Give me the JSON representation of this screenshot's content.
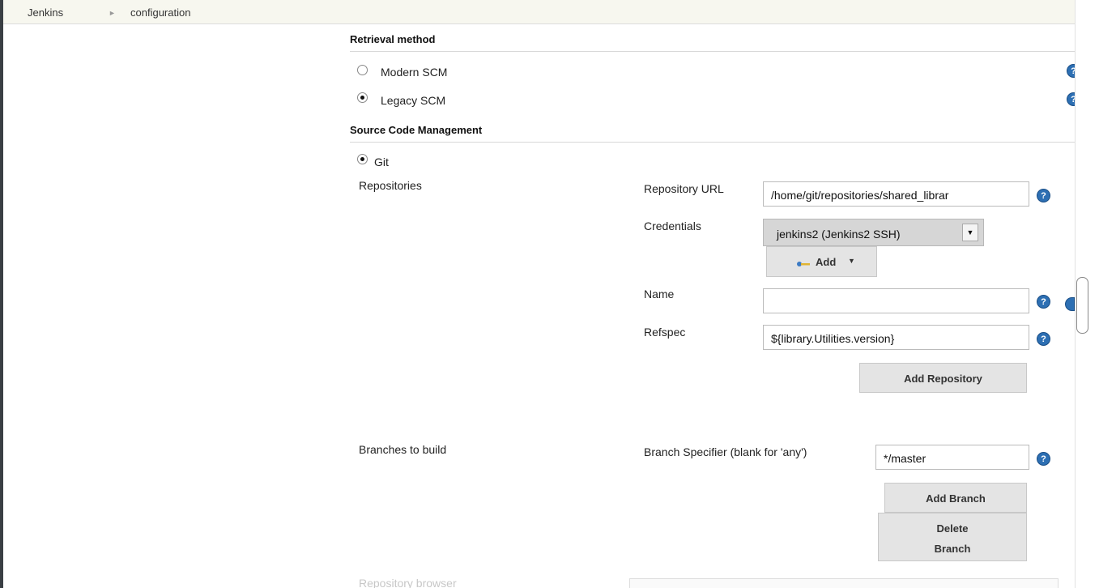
{
  "breadcrumb": {
    "root": "Jenkins",
    "page": "configuration"
  },
  "retrieval": {
    "title": "Retrieval method",
    "options": [
      {
        "label": "Modern SCM",
        "checked": false
      },
      {
        "label": "Legacy SCM",
        "checked": true
      }
    ]
  },
  "scm": {
    "title": "Source Code Management",
    "git_label": "Git",
    "repositories_label": "Repositories",
    "repo_url_label": "Repository URL",
    "repo_url_value": "/home/git/repositories/shared_librar",
    "credentials_label": "Credentials",
    "credentials_value": "jenkins2 (Jenkins2 SSH)",
    "add_label": "Add",
    "name_label": "Name",
    "name_value": "",
    "refspec_label": "Refspec",
    "refspec_value": "${library.Utilities.version}",
    "add_repository_label": "Add Repository",
    "branches_label": "Branches to build",
    "branch_specifier_label": "Branch Specifier (blank for 'any')",
    "branch_specifier_value": "*/master",
    "add_branch_label": "Add Branch",
    "delete_branch_line1": "Delete",
    "delete_branch_line2": "Branch",
    "repository_browser_label": "Repository browser"
  },
  "icons": {
    "help": "help-icon",
    "add": "key-add-icon",
    "dropdown": "caret-down-icon"
  },
  "colors": {
    "help": "#2d6fb3",
    "button": "#e4e4e4",
    "breadcrumb_bg": "#f7f7ef"
  }
}
